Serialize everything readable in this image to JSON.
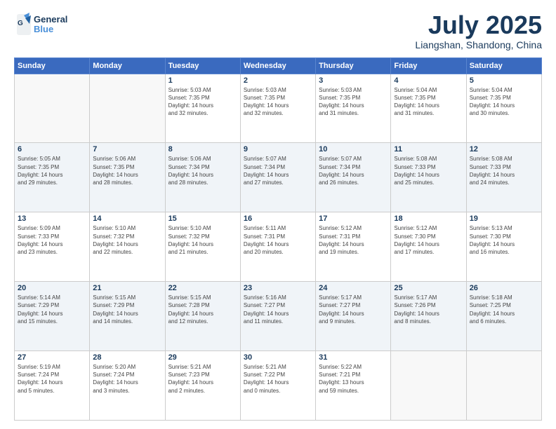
{
  "header": {
    "logo_line1": "General",
    "logo_line2": "Blue",
    "title": "July 2025",
    "subtitle": "Liangshan, Shandong, China"
  },
  "weekdays": [
    "Sunday",
    "Monday",
    "Tuesday",
    "Wednesday",
    "Thursday",
    "Friday",
    "Saturday"
  ],
  "weeks": [
    [
      {
        "day": "",
        "info": ""
      },
      {
        "day": "",
        "info": ""
      },
      {
        "day": "1",
        "info": "Sunrise: 5:03 AM\nSunset: 7:35 PM\nDaylight: 14 hours\nand 32 minutes."
      },
      {
        "day": "2",
        "info": "Sunrise: 5:03 AM\nSunset: 7:35 PM\nDaylight: 14 hours\nand 32 minutes."
      },
      {
        "day": "3",
        "info": "Sunrise: 5:03 AM\nSunset: 7:35 PM\nDaylight: 14 hours\nand 31 minutes."
      },
      {
        "day": "4",
        "info": "Sunrise: 5:04 AM\nSunset: 7:35 PM\nDaylight: 14 hours\nand 31 minutes."
      },
      {
        "day": "5",
        "info": "Sunrise: 5:04 AM\nSunset: 7:35 PM\nDaylight: 14 hours\nand 30 minutes."
      }
    ],
    [
      {
        "day": "6",
        "info": "Sunrise: 5:05 AM\nSunset: 7:35 PM\nDaylight: 14 hours\nand 29 minutes."
      },
      {
        "day": "7",
        "info": "Sunrise: 5:06 AM\nSunset: 7:35 PM\nDaylight: 14 hours\nand 28 minutes."
      },
      {
        "day": "8",
        "info": "Sunrise: 5:06 AM\nSunset: 7:34 PM\nDaylight: 14 hours\nand 28 minutes."
      },
      {
        "day": "9",
        "info": "Sunrise: 5:07 AM\nSunset: 7:34 PM\nDaylight: 14 hours\nand 27 minutes."
      },
      {
        "day": "10",
        "info": "Sunrise: 5:07 AM\nSunset: 7:34 PM\nDaylight: 14 hours\nand 26 minutes."
      },
      {
        "day": "11",
        "info": "Sunrise: 5:08 AM\nSunset: 7:33 PM\nDaylight: 14 hours\nand 25 minutes."
      },
      {
        "day": "12",
        "info": "Sunrise: 5:08 AM\nSunset: 7:33 PM\nDaylight: 14 hours\nand 24 minutes."
      }
    ],
    [
      {
        "day": "13",
        "info": "Sunrise: 5:09 AM\nSunset: 7:33 PM\nDaylight: 14 hours\nand 23 minutes."
      },
      {
        "day": "14",
        "info": "Sunrise: 5:10 AM\nSunset: 7:32 PM\nDaylight: 14 hours\nand 22 minutes."
      },
      {
        "day": "15",
        "info": "Sunrise: 5:10 AM\nSunset: 7:32 PM\nDaylight: 14 hours\nand 21 minutes."
      },
      {
        "day": "16",
        "info": "Sunrise: 5:11 AM\nSunset: 7:31 PM\nDaylight: 14 hours\nand 20 minutes."
      },
      {
        "day": "17",
        "info": "Sunrise: 5:12 AM\nSunset: 7:31 PM\nDaylight: 14 hours\nand 19 minutes."
      },
      {
        "day": "18",
        "info": "Sunrise: 5:12 AM\nSunset: 7:30 PM\nDaylight: 14 hours\nand 17 minutes."
      },
      {
        "day": "19",
        "info": "Sunrise: 5:13 AM\nSunset: 7:30 PM\nDaylight: 14 hours\nand 16 minutes."
      }
    ],
    [
      {
        "day": "20",
        "info": "Sunrise: 5:14 AM\nSunset: 7:29 PM\nDaylight: 14 hours\nand 15 minutes."
      },
      {
        "day": "21",
        "info": "Sunrise: 5:15 AM\nSunset: 7:29 PM\nDaylight: 14 hours\nand 14 minutes."
      },
      {
        "day": "22",
        "info": "Sunrise: 5:15 AM\nSunset: 7:28 PM\nDaylight: 14 hours\nand 12 minutes."
      },
      {
        "day": "23",
        "info": "Sunrise: 5:16 AM\nSunset: 7:27 PM\nDaylight: 14 hours\nand 11 minutes."
      },
      {
        "day": "24",
        "info": "Sunrise: 5:17 AM\nSunset: 7:27 PM\nDaylight: 14 hours\nand 9 minutes."
      },
      {
        "day": "25",
        "info": "Sunrise: 5:17 AM\nSunset: 7:26 PM\nDaylight: 14 hours\nand 8 minutes."
      },
      {
        "day": "26",
        "info": "Sunrise: 5:18 AM\nSunset: 7:25 PM\nDaylight: 14 hours\nand 6 minutes."
      }
    ],
    [
      {
        "day": "27",
        "info": "Sunrise: 5:19 AM\nSunset: 7:24 PM\nDaylight: 14 hours\nand 5 minutes."
      },
      {
        "day": "28",
        "info": "Sunrise: 5:20 AM\nSunset: 7:24 PM\nDaylight: 14 hours\nand 3 minutes."
      },
      {
        "day": "29",
        "info": "Sunrise: 5:21 AM\nSunset: 7:23 PM\nDaylight: 14 hours\nand 2 minutes."
      },
      {
        "day": "30",
        "info": "Sunrise: 5:21 AM\nSunset: 7:22 PM\nDaylight: 14 hours\nand 0 minutes."
      },
      {
        "day": "31",
        "info": "Sunrise: 5:22 AM\nSunset: 7:21 PM\nDaylight: 13 hours\nand 59 minutes."
      },
      {
        "day": "",
        "info": ""
      },
      {
        "day": "",
        "info": ""
      }
    ]
  ]
}
